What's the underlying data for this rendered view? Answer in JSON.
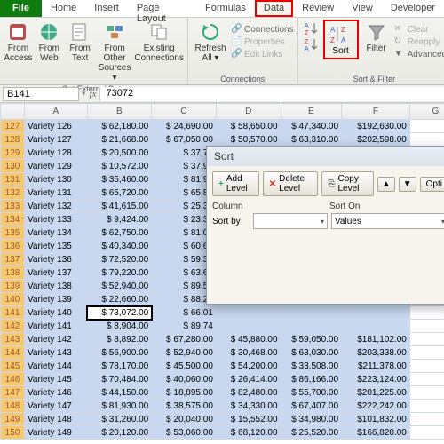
{
  "tabs": {
    "file": "File",
    "home": "Home",
    "insert": "Insert",
    "pagelayout": "Page Layout",
    "formulas": "Formulas",
    "data": "Data",
    "review": "Review",
    "view": "View",
    "developer": "Developer"
  },
  "ribbon": {
    "ext": {
      "access": "From Access",
      "web": "From Web",
      "text": "From Text",
      "other": "From Other Sources ▾",
      "existing": "Existing Connections",
      "label": "Get External Data"
    },
    "conn": {
      "refresh": "Refresh All ▾",
      "connections": "Connections",
      "properties": "Properties",
      "editlinks": "Edit Links",
      "label": "Connections"
    },
    "sort": {
      "sort": "Sort",
      "filter": "Filter",
      "clear": "Clear",
      "reapply": "Reapply",
      "advanced": "Advanced",
      "label": "Sort & Filter"
    }
  },
  "namebox": "B141",
  "formula": "73072",
  "cols": [
    "",
    "A",
    "B",
    "C",
    "D",
    "E",
    "F",
    "G"
  ],
  "rows": [
    {
      "n": 127,
      "a": "Variety 126",
      "b": "$  62,180.00",
      "c": "$  24,690.00",
      "d": "$  58,650.00",
      "e": "$ 47,340.00",
      "f": "$192,630.00"
    },
    {
      "n": 128,
      "a": "Variety 127",
      "b": "$  21,668.00",
      "c": "$  67,050.00",
      "d": "$  50,570.00",
      "e": "$ 63,310.00",
      "f": "$202,598.00"
    },
    {
      "n": 129,
      "a": "Variety 128",
      "b": "$  20,500.00",
      "c": "$  37,76",
      "d": "",
      "e": "",
      "f": ""
    },
    {
      "n": 130,
      "a": "Variety 129",
      "b": "$  10,572.00",
      "c": "$  37,98",
      "d": "",
      "e": "",
      "f": ""
    },
    {
      "n": 131,
      "a": "Variety 130",
      "b": "$  35,460.00",
      "c": "$  81,98",
      "d": "",
      "e": "",
      "f": ""
    },
    {
      "n": 132,
      "a": "Variety 131",
      "b": "$  65,720.00",
      "c": "$  65,89",
      "d": "",
      "e": "",
      "f": ""
    },
    {
      "n": 133,
      "a": "Variety 132",
      "b": "$  41,615.00",
      "c": "$  25,31",
      "d": "",
      "e": "",
      "f": ""
    },
    {
      "n": 134,
      "a": "Variety 133",
      "b": "$    9,424.00",
      "c": "$  23,33",
      "d": "",
      "e": "",
      "f": ""
    },
    {
      "n": 135,
      "a": "Variety 134",
      "b": "$  62,750.00",
      "c": "$  81,01",
      "d": "",
      "e": "",
      "f": ""
    },
    {
      "n": 136,
      "a": "Variety 135",
      "b": "$  40,340.00",
      "c": "$  60,64",
      "d": "",
      "e": "",
      "f": ""
    },
    {
      "n": 137,
      "a": "Variety 136",
      "b": "$  72,520.00",
      "c": "$  59,32",
      "d": "",
      "e": "",
      "f": ""
    },
    {
      "n": 138,
      "a": "Variety 137",
      "b": "$  79,220.00",
      "c": "$  63,67",
      "d": "",
      "e": "",
      "f": ""
    },
    {
      "n": 139,
      "a": "Variety 138",
      "b": "$  52,940.00",
      "c": "$  89,52",
      "d": "",
      "e": "",
      "f": ""
    },
    {
      "n": 140,
      "a": "Variety 139",
      "b": "$  22,660.00",
      "c": "$  88,24",
      "d": "",
      "e": "",
      "f": ""
    },
    {
      "n": 141,
      "a": "Variety 140",
      "b": "$ 73,072.00",
      "c": "$  66,01",
      "d": "",
      "e": "",
      "f": "",
      "active": true
    },
    {
      "n": 142,
      "a": "Variety 141",
      "b": "$    8,904.00",
      "c": "$  89,74",
      "d": "",
      "e": "",
      "f": ""
    },
    {
      "n": 143,
      "a": "Variety 142",
      "b": "$    8,892.00",
      "c": "$  67,280.00",
      "d": "$  45,880.00",
      "e": "$ 59,050.00",
      "f": "$181,102.00"
    },
    {
      "n": 144,
      "a": "Variety 143",
      "b": "$  56,900.00",
      "c": "$  52,940.00",
      "d": "$  30,468.00",
      "e": "$ 63,030.00",
      "f": "$203,338.00"
    },
    {
      "n": 145,
      "a": "Variety 144",
      "b": "$  78,170.00",
      "c": "$  45,500.00",
      "d": "$  54,200.00",
      "e": "$ 33,508.00",
      "f": "$211,378.00"
    },
    {
      "n": 146,
      "a": "Variety 145",
      "b": "$  70,484.00",
      "c": "$  40,060.00",
      "d": "$  26,414.00",
      "e": "$ 86,166.00",
      "f": "$223,124.00"
    },
    {
      "n": 147,
      "a": "Variety 146",
      "b": "$  44,150.00",
      "c": "$  18,895.00",
      "d": "$  82,480.00",
      "e": "$ 55,700.00",
      "f": "$201,225.00"
    },
    {
      "n": 148,
      "a": "Variety 147",
      "b": "$  81,930.00",
      "c": "$  38,575.00",
      "d": "$  34,330.00",
      "e": "$ 67,407.00",
      "f": "$222,242.00"
    },
    {
      "n": 149,
      "a": "Variety 148",
      "b": "$  31,260.00",
      "c": "$  20,040.00",
      "d": "$  15,552.00",
      "e": "$ 34,980.00",
      "f": "$101,832.00"
    },
    {
      "n": 150,
      "a": "Variety 149",
      "b": "$  20,120.00",
      "c": "$  53,060.00",
      "d": "$  68,120.00",
      "e": "$ 25,520.00",
      "f": "$166,820.00"
    }
  ],
  "dialog": {
    "title": "Sort",
    "addlevel": "Add Level",
    "deletelevel": "Delete Level",
    "copylevel": "Copy Level",
    "options": "Opti",
    "col": "Column",
    "sorton": "Sort On",
    "sortby": "Sort by",
    "values": "Values"
  }
}
